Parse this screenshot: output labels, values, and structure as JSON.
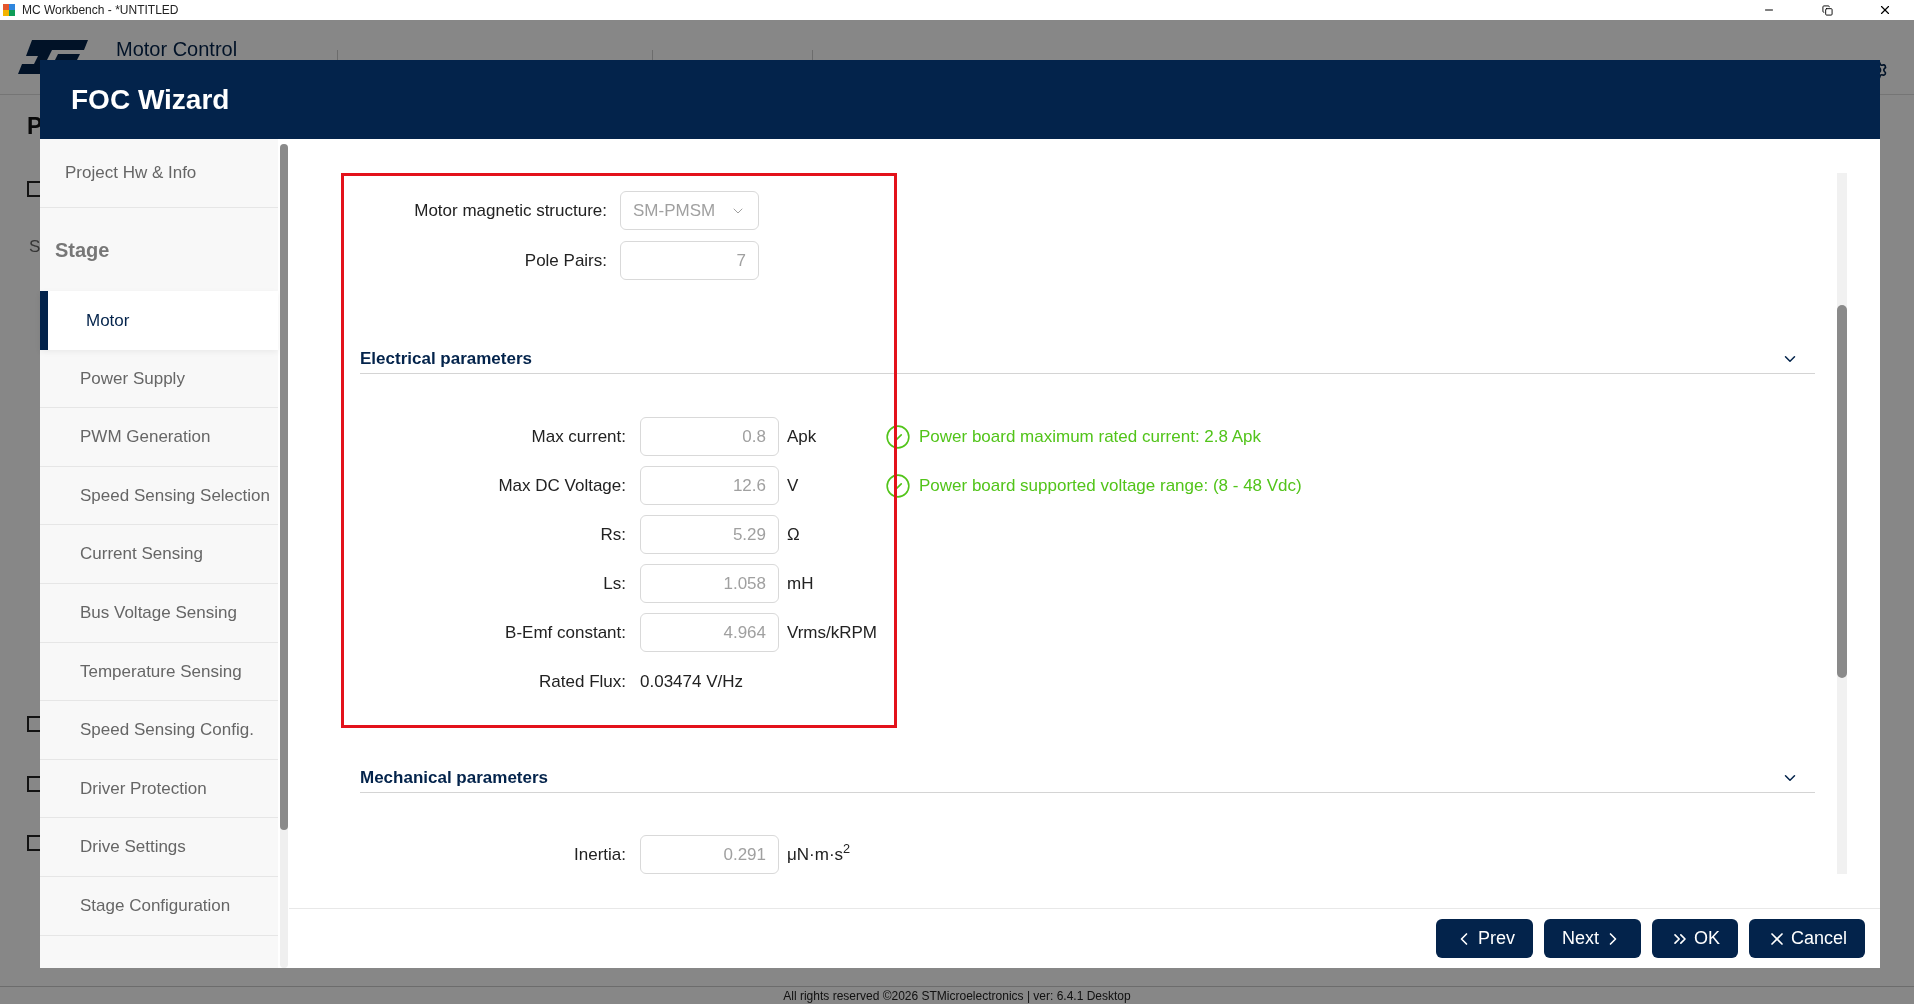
{
  "titlebar": {
    "title": "MC Workbench - *UNTITLED"
  },
  "app_header": {
    "brand": "Motor Control"
  },
  "background": {
    "heading": "P",
    "label": "S",
    "checkboxes": [
      {
        "checked": false
      },
      {
        "checked": false
      },
      {
        "checked": false
      },
      {
        "checked": false
      }
    ],
    "footer": "All rights reserved ©2026 STMicroelectronics | ver: 6.4.1 Desktop"
  },
  "dialog": {
    "title": "FOC Wizard",
    "sidebar": [
      {
        "label": "Project Hw & Info",
        "kind": "top",
        "selected": false
      },
      {
        "label": "Stage",
        "kind": "heading"
      },
      {
        "label": "Motor",
        "kind": "step",
        "selected": true
      },
      {
        "label": "Power Supply",
        "kind": "step",
        "selected": false
      },
      {
        "label": "PWM Generation",
        "kind": "step",
        "selected": false
      },
      {
        "label": "Speed Sensing Selection",
        "kind": "step",
        "selected": false
      },
      {
        "label": "Current Sensing",
        "kind": "step",
        "selected": false
      },
      {
        "label": "Bus Voltage Sensing",
        "kind": "step",
        "selected": false
      },
      {
        "label": "Temperature Sensing",
        "kind": "step",
        "selected": false
      },
      {
        "label": "Speed Sensing Config.",
        "kind": "step",
        "selected": false
      },
      {
        "label": "Driver Protection",
        "kind": "step",
        "selected": false
      },
      {
        "label": "Drive Settings",
        "kind": "step",
        "selected": false
      },
      {
        "label": "Stage Configuration",
        "kind": "step",
        "selected": false
      }
    ],
    "general": [
      {
        "label": "Motor magnetic structure:",
        "kind": "select",
        "value": "SM-PMSM",
        "disabled": true
      },
      {
        "label": "Pole Pairs:",
        "kind": "input",
        "value": "7",
        "disabled": true
      }
    ],
    "sections": [
      {
        "title": "Electrical parameters",
        "expanded": true,
        "rows": [
          {
            "label": "Max current:",
            "kind": "input",
            "value": "0.8",
            "unit": "Apk",
            "disabled": true,
            "status": {
              "kind": "ok",
              "text": "Power board maximum rated current: 2.8 Apk"
            }
          },
          {
            "label": "Max DC Voltage:",
            "kind": "input",
            "value": "12.6",
            "unit": "V",
            "disabled": true,
            "status": {
              "kind": "ok",
              "text": "Power board supported voltage range: (8 - 48 Vdc)"
            }
          },
          {
            "label": "Rs:",
            "kind": "input",
            "value": "5.29",
            "unit": "Ω",
            "disabled": true
          },
          {
            "label": "Ls:",
            "kind": "input",
            "value": "1.058",
            "unit": "mH",
            "disabled": true
          },
          {
            "label": "B-Emf constant:",
            "kind": "input",
            "value": "4.964",
            "unit": "Vrms/kRPM",
            "disabled": true
          },
          {
            "label": "Rated Flux:",
            "kind": "text",
            "value": "0.03474 V/Hz"
          }
        ]
      },
      {
        "title": "Mechanical parameters",
        "expanded": true,
        "rows": [
          {
            "label": "Inertia:",
            "kind": "input",
            "value": "0.291",
            "unit": "μN·m·s$^{2}$",
            "disabled": true
          }
        ]
      }
    ],
    "buttons": [
      {
        "label": "Prev",
        "kind": "prev"
      },
      {
        "label": "Next",
        "kind": "next"
      },
      {
        "label": "OK",
        "kind": "ok"
      },
      {
        "label": "Cancel",
        "kind": "cancel"
      }
    ]
  }
}
